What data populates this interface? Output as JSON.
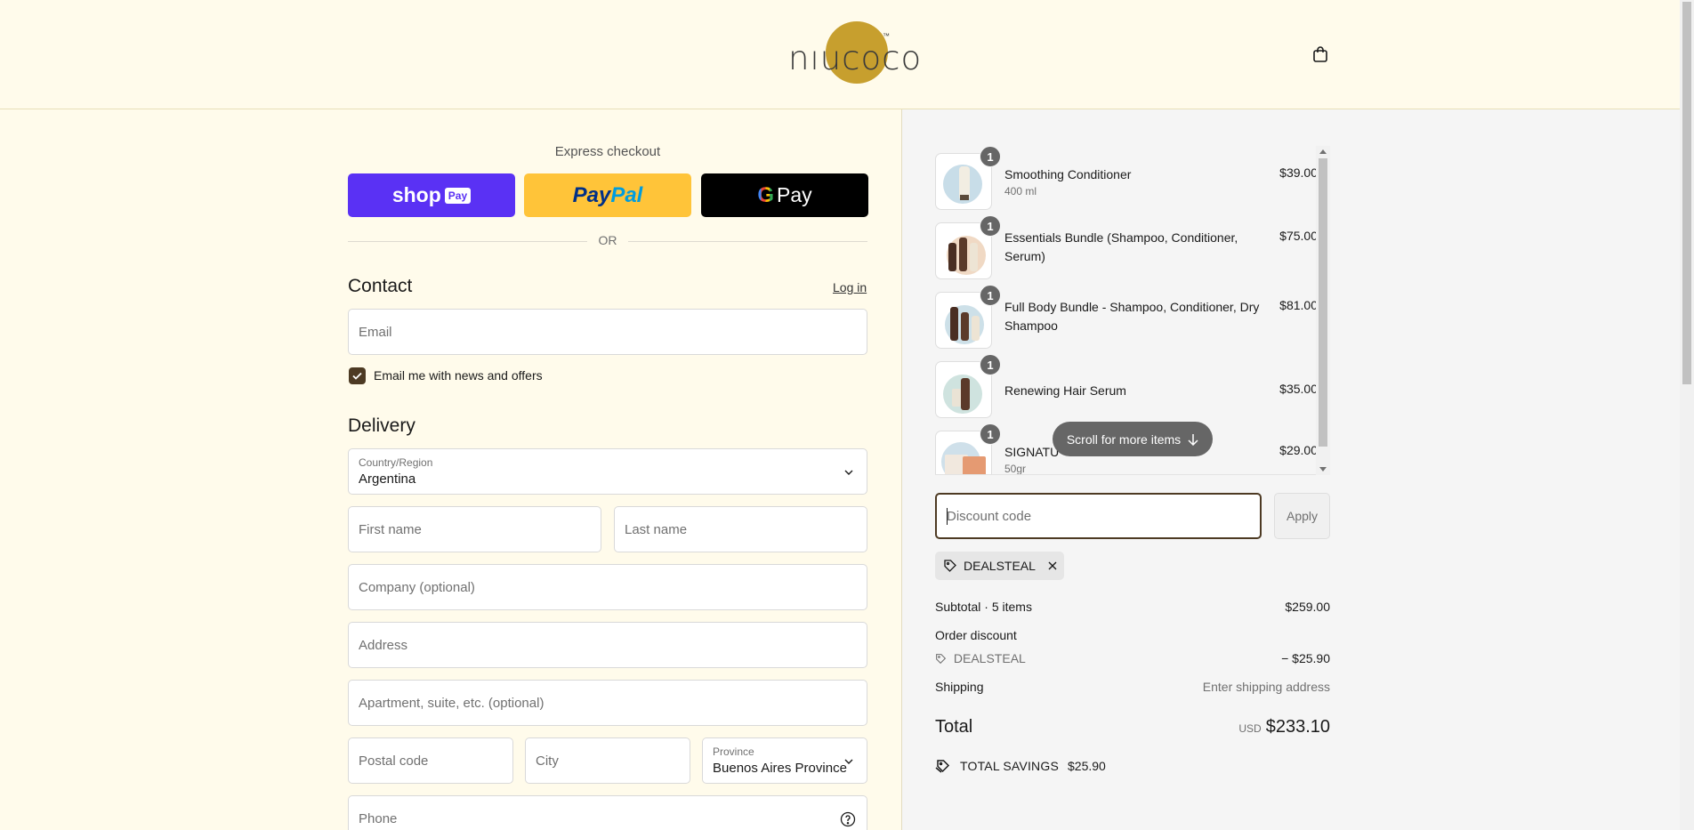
{
  "header": {
    "logo_text": "nıucoco",
    "logo_tm": "™"
  },
  "express": {
    "title": "Express checkout",
    "shop_label": "shop",
    "shop_pay": "Pay",
    "paypal_a": "Pay",
    "paypal_b": "Pal",
    "gpay_g": "G",
    "gpay_label": "Pay",
    "or": "OR"
  },
  "contact": {
    "heading": "Contact",
    "login": "Log in",
    "email_placeholder": "Email",
    "newsletter": "Email me with news and offers"
  },
  "delivery": {
    "heading": "Delivery",
    "country_label": "Country/Region",
    "country_value": "Argentina",
    "first_name": "First name",
    "last_name": "Last name",
    "company": "Company (optional)",
    "address": "Address",
    "apartment": "Apartment, suite, etc. (optional)",
    "postal": "Postal code",
    "city": "City",
    "province_label": "Province",
    "province_value": "Buenos Aires Province",
    "phone": "Phone"
  },
  "items": [
    {
      "name": "Smoothing Conditioner",
      "sub": "400 ml",
      "price": "$39.00",
      "qty": "1"
    },
    {
      "name": "Essentials Bundle (Shampoo, Conditioner, Serum)",
      "sub": "",
      "price": "$75.00",
      "qty": "1"
    },
    {
      "name": "Full Body Bundle - Shampoo, Conditioner, Dry Shampoo",
      "sub": "",
      "price": "$81.00",
      "qty": "1"
    },
    {
      "name": "Renewing Hair Serum",
      "sub": "",
      "price": "$35.00",
      "qty": "1"
    },
    {
      "name": "SIGNATU",
      "sub": "50gr",
      "price": "$29.00",
      "qty": "1"
    }
  ],
  "scroll_more": "Scroll for more items",
  "discount": {
    "placeholder": "Discount code",
    "apply": "Apply",
    "tag": "DEALSTEAL"
  },
  "summary": {
    "subtotal_label": "Subtotal · 5 items",
    "subtotal": "$259.00",
    "order_discount": "Order discount",
    "code": "DEALSTEAL",
    "discount_amount": "− $25.90",
    "shipping_label": "Shipping",
    "shipping_value": "Enter shipping address",
    "total_label": "Total",
    "currency": "USD",
    "total": "$233.10",
    "savings_label": "TOTAL SAVINGS",
    "savings": "$25.90"
  }
}
